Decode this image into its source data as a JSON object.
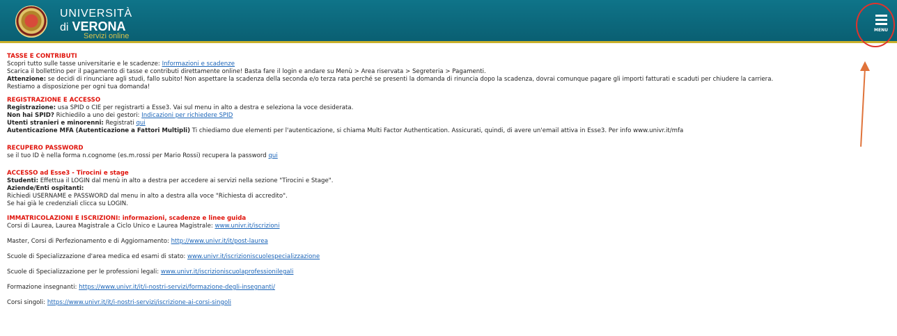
{
  "header": {
    "brand_line1": "UNIVERSITÀ",
    "brand_di": "di",
    "brand_verona": "VERONA",
    "subtitle": "Servizi online",
    "menu_label": "MENU",
    "colors": {
      "bar": "#0a6a80",
      "gold": "#c9b02a",
      "alert_red": "#e0140c",
      "annotation": "#e0332c"
    }
  },
  "tasse": {
    "title": "TASSE E CONTRIBUTI",
    "l1_text": "Scopri tutto sulle tasse universitarie e le scadenze: ",
    "l1_link": "Informazioni e scadenze",
    "l2": "Scarica il bollettino per il pagamento di tasse e contributi direttamente online! Basta fare il login e andare su Menù > Area riservata > Segreteria > Pagamenti.",
    "l3_bold": "Attenzione:",
    "l3_text": " se decidi di rinunciare agli studi, fallo subito! Non aspettare la scadenza della seconda e/o terza rata perché se presenti la domanda di rinuncia dopo la scadenza, dovrai comunque pagare gli importi fatturati e scaduti per chiudere la carriera.",
    "l4": "Restiamo a disposizione per ogni tua domanda!"
  },
  "registrazione": {
    "title": "REGISTRAZIONE E ACCESSO",
    "l1_bold": "Registrazione:",
    "l1_text": " usa SPID o CIE per registrarti a Esse3. Vai sul menu in alto a destra e seleziona la voce desiderata.",
    "l2_bold": "Non hai SPID?",
    "l2_text": " Richiedilo a uno dei gestori: ",
    "l2_link": "Indicazioni per richiedere SPID",
    "l3_bold": "Utenti stranieri e minorenni:",
    "l3_text": " Registrati ",
    "l3_link": "qui",
    "l4_bold": "Autenticazione MFA (Autenticazione a Fattori Multipli)",
    "l4_text": " Ti chiediamo due elementi per l'autenticazione, si chiama Multi Factor Authentication. Assicurati, quindi, di avere un'email attiva in Esse3. Per info www.univr.it/mfa"
  },
  "recupero": {
    "title": "RECUPERO PASSWORD",
    "l1_text": "se il tuo ID è nella forma n.cognome (es.m.rossi per Mario Rossi) recupera la password ",
    "l1_link": "qui"
  },
  "accesso": {
    "title": "ACCESSO ad Esse3 - Tirocini e stage",
    "l1_bold": "Studenti:",
    "l1_text": " Effettua il LOGIN dal menù in alto a destra per accedere ai servizi nella sezione \"Tirocini e Stage\".",
    "l2_bold": "Aziende/Enti ospitanti:",
    "l3": "Richiedi USERNAME e PASSWORD dal menu in alto a destra alla voce \"Richiesta di accredito\".",
    "l4": "Se hai già le credenziali clicca su LOGIN."
  },
  "immatricolazioni": {
    "title": "IMMATRICOLAZIONI E ISCRIZIONI: informazioni, scadenze e linee guida",
    "items": [
      {
        "text": "Corsi di Laurea, Laurea Magistrale a Ciclo Unico e Laurea Magistrale: ",
        "link": "www.univr.it/iscrizioni"
      },
      {
        "text": "Master, Corsi di Perfezionamento e di Aggiornamento: ",
        "link": "http://www.univr.it/it/post-laurea"
      },
      {
        "text": "Scuole di Specializzazione d'area medica ed esami di stato: ",
        "link": "www.univr.it/iscrizioniscuolespecializzazione"
      },
      {
        "text": "Scuole di Specializzazione per le professioni legali: ",
        "link": "www.univr.it/iscrizioniscuolaprofessionilegali"
      },
      {
        "text": "Formazione insegnanti: ",
        "link": "https://www.univr.it/it/i-nostri-servizi/formazione-degli-insegnanti/"
      },
      {
        "text": "Corsi singoli: ",
        "link": "https://www.univr.it/it/i-nostri-servizi/iscrizione-ai-corsi-singoli"
      }
    ]
  }
}
